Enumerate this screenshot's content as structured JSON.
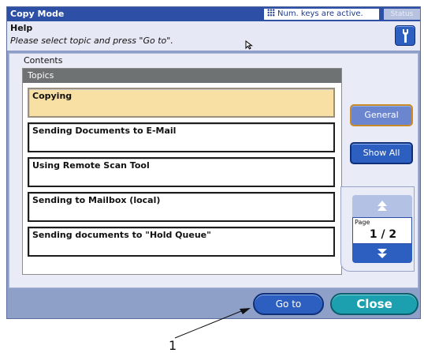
{
  "window": {
    "title": "Copy Mode",
    "numkeys_text": "Num. keys are active.",
    "status_label": "Status"
  },
  "help": {
    "heading": "Help",
    "instruction": "Please select topic and press \"Go to\"."
  },
  "contents": {
    "label": "Contents",
    "topics_header": "Topics",
    "topics": [
      {
        "label": "Copying",
        "selected": true
      },
      {
        "label": "Sending Documents to E-Mail",
        "selected": false
      },
      {
        "label": "Using Remote Scan Tool",
        "selected": false
      },
      {
        "label": "Sending to Mailbox (local)",
        "selected": false
      },
      {
        "label": "Sending documents to \"Hold Queue\"",
        "selected": false
      }
    ]
  },
  "side_buttons": {
    "general": "General",
    "show_all": "Show All"
  },
  "pager": {
    "label": "Page",
    "value": "1 / 2"
  },
  "footer": {
    "goto": "Go to",
    "close": "Close"
  },
  "callout": {
    "number": "1"
  },
  "colors": {
    "titlebar": "#2d4fa6",
    "button_blue": "#2d5fc0",
    "close_teal": "#1ca0b0",
    "selected_topic": "#f8dfa4"
  },
  "icons": {
    "help_tool": "wrench-icon",
    "page_up": "arrow-up-icon",
    "page_down": "arrow-down-icon",
    "pointer": "mouse-pointer-icon"
  }
}
